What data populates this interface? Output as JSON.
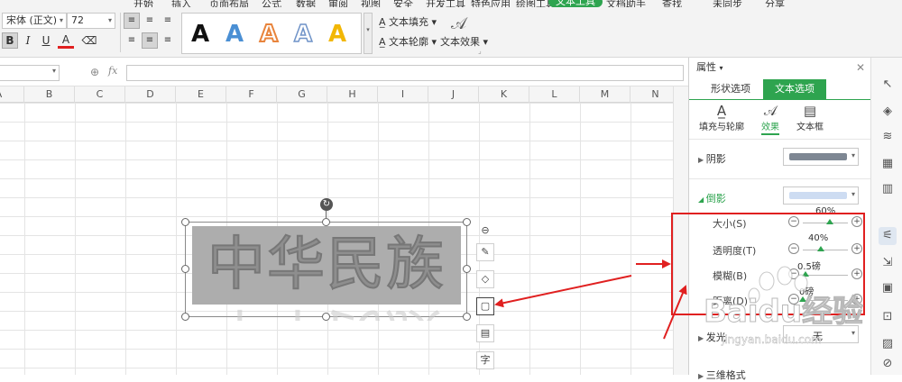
{
  "menubar": {
    "items": [
      "开始",
      "插入",
      "页面布局",
      "公式",
      "数据",
      "审阅",
      "视图",
      "安全",
      "开发工具",
      "特色应用",
      "绘图工具"
    ],
    "active": "文本工具",
    "after": [
      "文档助手"
    ],
    "search": "查找",
    "sync": "未同步",
    "share": "分享"
  },
  "ribbon": {
    "font_name": "宋体 (正文)",
    "font_size": "72",
    "bold": "B",
    "italic": "I",
    "underline": "U",
    "font_color": "A",
    "wordart_glyph": "A",
    "text_fill": "文本填充",
    "text_outline": "文本轮廓",
    "text_effect": "文本效果"
  },
  "formula_bar": {
    "fx": "fx"
  },
  "columns": [
    "A",
    "B",
    "C",
    "D",
    "E",
    "F",
    "G",
    "H",
    "I",
    "J",
    "K",
    "L",
    "M",
    "N"
  ],
  "textbox": {
    "text": "中华民族"
  },
  "side_panel": {
    "title": "属性",
    "tabs": [
      "形状选项",
      "文本选项"
    ],
    "subtabs": [
      "填充与轮廓",
      "效果",
      "文本框"
    ],
    "shadow": "阴影",
    "reflection": "倒影",
    "sliders": [
      {
        "label": "大小(S)",
        "value": "60%",
        "level": 0.6
      },
      {
        "label": "透明度(T)",
        "value": "40%",
        "level": 0.4
      },
      {
        "label": "模糊(B)",
        "value": "0.5磅",
        "level": 0.05
      },
      {
        "label": "距离(D)",
        "value": "0磅",
        "level": 0.0
      }
    ],
    "glow": "发光",
    "glow_value": "无",
    "three_d": "三维格式"
  },
  "watermark": {
    "brand": "Baidu经验",
    "url": "jingyan.baidu.com"
  },
  "colors": {
    "accent": "#2ea44f",
    "annotation": "#e02020"
  }
}
